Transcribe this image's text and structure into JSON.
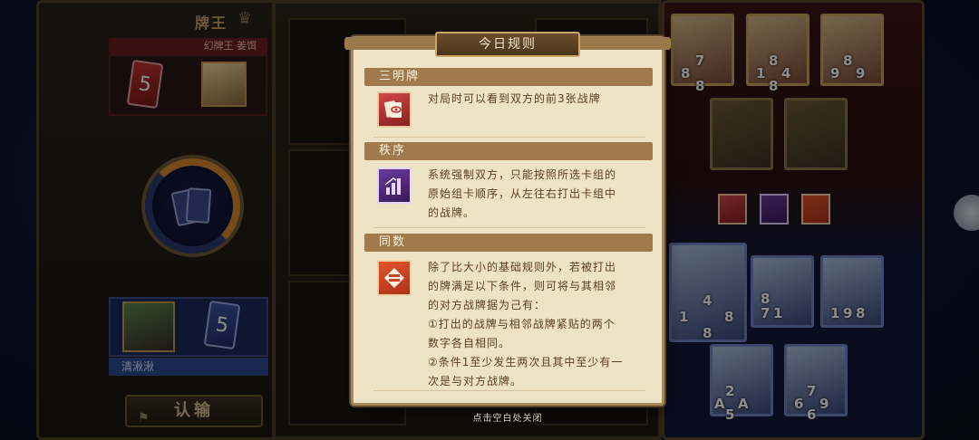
{
  "opponent": {
    "rank_title": "牌王",
    "name": "幻牌王 姜饵",
    "cards_left": "5"
  },
  "player": {
    "name": "清湫湫",
    "cards_left": "5"
  },
  "buttons": {
    "surrender": "认输"
  },
  "modal": {
    "title": "今日规则",
    "rules": [
      {
        "name": "三明牌",
        "icon": "eye-card-icon",
        "lines": [
          "对局时可以看到双方的前3张战牌"
        ]
      },
      {
        "name": "秩序",
        "icon": "ascending-bars-icon",
        "lines": [
          "系统强制双方，只能按照所选卡组的",
          "原始组卡顺序，从左往右打出卡组中",
          "的战牌。"
        ]
      },
      {
        "name": "同数",
        "icon": "equals-icon",
        "lines": [
          "除了比大小的基础规则外，若被打出",
          "的牌满足以下条件，则可将与其相邻",
          "的对方战牌据为己有：",
          "①打出的战牌与相邻战牌紧贴的两个",
          "数字各自相同。",
          "②条件1至少发生两次且其中至少有一",
          "次是与对方战牌。"
        ]
      }
    ],
    "close_hint": "点击空白处关闭"
  },
  "board": {
    "opponent_hand_numbers": [
      [
        "7",
        "8",
        "8"
      ],
      [
        "8",
        "1",
        "4",
        "8"
      ],
      [
        "9",
        "8",
        "9"
      ]
    ],
    "player_hand_numbers": [
      [
        "4",
        "1",
        "8",
        "8"
      ],
      [
        "8",
        "7",
        "1"
      ],
      [
        "1",
        "9",
        "8"
      ],
      [
        "2",
        "A",
        "A",
        "5"
      ],
      [
        "7",
        "6",
        "9",
        "6"
      ]
    ]
  },
  "colors": {
    "modal_bg": "#efe3c6",
    "header_bg": "#a07a4a",
    "text": "#5a3e1f"
  }
}
